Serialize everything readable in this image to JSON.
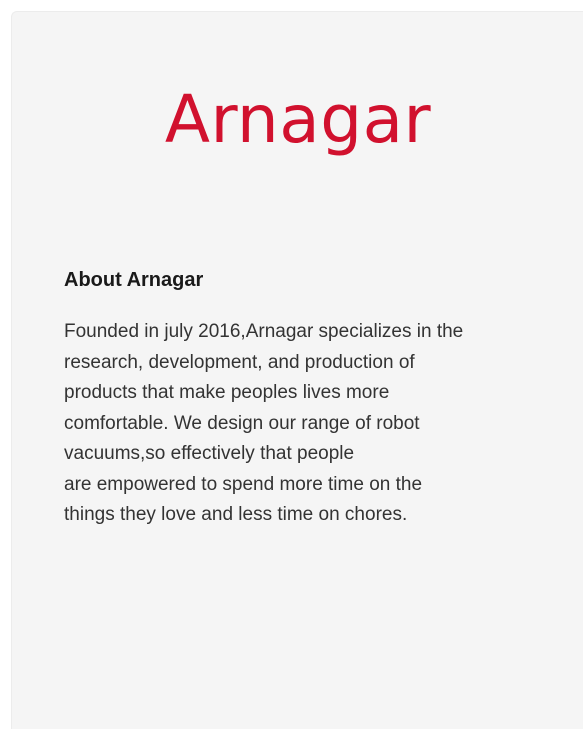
{
  "brand": {
    "logo_text": "Arnagar",
    "color": "#d1112e"
  },
  "about": {
    "title": "About Arnagar",
    "lines": [
      "Founded in july 2016,Arnagar specializes in the",
      "research, development, and production of",
      "products that make peoples lives more",
      "comfortable. We design our range of robot",
      "vacuums,so effectively that people",
      "are empowered to spend more time on the",
      "things they love and less time on chores."
    ]
  }
}
